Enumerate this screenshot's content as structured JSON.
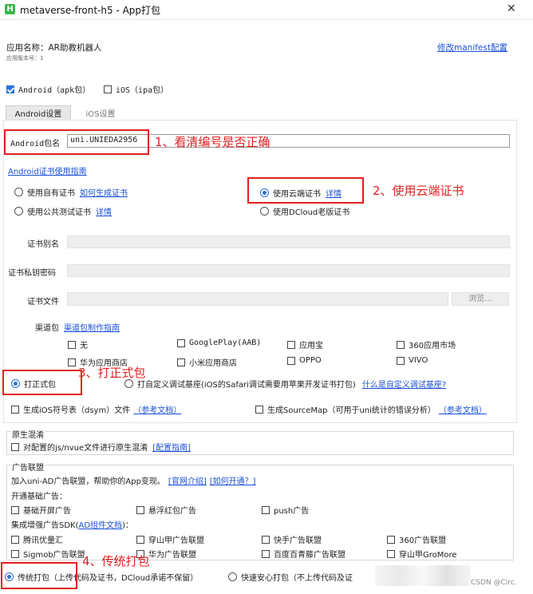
{
  "window": {
    "title": "metaverse-front-h5 - App打包",
    "close_glyph": "✕"
  },
  "app": {
    "name_label": "应用名称：AR助教机器人",
    "version_label": "应用版本号：1",
    "modify_manifest_link": "修改manifest配置"
  },
  "platforms": {
    "android": "Android（apk包）",
    "ios": "iOS（ipa包）"
  },
  "tabs": {
    "android": "Android设置",
    "ios": "iOS设置"
  },
  "android": {
    "package_label": "Android包名",
    "package_value": "uni.UNIEDA2956",
    "cert_guide_link": "Android证书使用指南",
    "own_cert": "使用自有证书",
    "how_generate_link": "如何生成证书",
    "public_test_cert": "使用公共测试证书",
    "details_link": "详情",
    "cloud_cert": "使用云端证书",
    "cloud_details_link": "详情",
    "dcloud_old_cert": "使用DCloud老版证书",
    "alias_label": "证书别名",
    "key_password_label": "证书私钥密码",
    "cert_file_label": "证书文件",
    "browse_button": "浏览...",
    "channel_label": "渠道包",
    "channel_guide_link": "渠道包制作指南",
    "channels": [
      [
        "无",
        "GooglePlay(AAB)",
        "应用宝",
        "360应用市场"
      ],
      [
        "华为应用商店",
        "小米应用商店",
        "OPPO",
        "VIVO"
      ]
    ]
  },
  "build_type": {
    "formal": "打正式包",
    "custom_base": "打自定义调试基座(iOS的Safari调试需要用苹果开发证书打包)",
    "what_is_custom_link": "什么是自定义调试基座?",
    "ios_symbol": "生成iOS符号表（dsym）文件",
    "ios_symbol_doc_link": "（参考文档）",
    "sourcemap": "生成SourceMap（可用于uni统计的错误分析）",
    "sourcemap_doc_link": "（参考文档）"
  },
  "obfuscation": {
    "title": "原生混淆",
    "option": "对配置的js/nvue文件进行原生混淆",
    "guide_link": "[配置指南]"
  },
  "ads": {
    "title": "广告联盟",
    "intro": "加入uni-AD广告联盟，帮助你的App变现。",
    "intro_link": "[官网介绍]",
    "open_link": "[如何开通？]",
    "basic_label": "开通基础广告：",
    "basic": [
      "基础开屏广告",
      "悬浮红包广告",
      "push广告"
    ],
    "enhanced_prefix": "集成增强广告SDK(",
    "enhanced_link": "AD组件文档",
    "enhanced_suffix": ")：",
    "enhanced": [
      [
        "腾讯优量汇",
        "穿山甲广告联盟",
        "快手广告联盟",
        "360广告联盟"
      ],
      [
        "Sigmob广告联盟",
        "华为广告联盟",
        "百度百青藤广告联盟",
        "穿山甲GroMore"
      ]
    ]
  },
  "packaging": {
    "traditional": "传统打包（上传代码及证书，DCloud承诺不保留）",
    "quick": "快速安心打包（不上传代码及证"
  },
  "annotations": {
    "step1": "1、看清编号是否正确",
    "step2": "2、使用云端证书",
    "step3": "3、打正式包",
    "step4": "4、传统打包"
  },
  "watermark": "CSDN @Circ.",
  "colors": {
    "link": "#1a4fd6",
    "annotation_red": "#e0201f",
    "accent_blue": "#2a6fdb",
    "app_icon_green": "#3cb54a"
  }
}
